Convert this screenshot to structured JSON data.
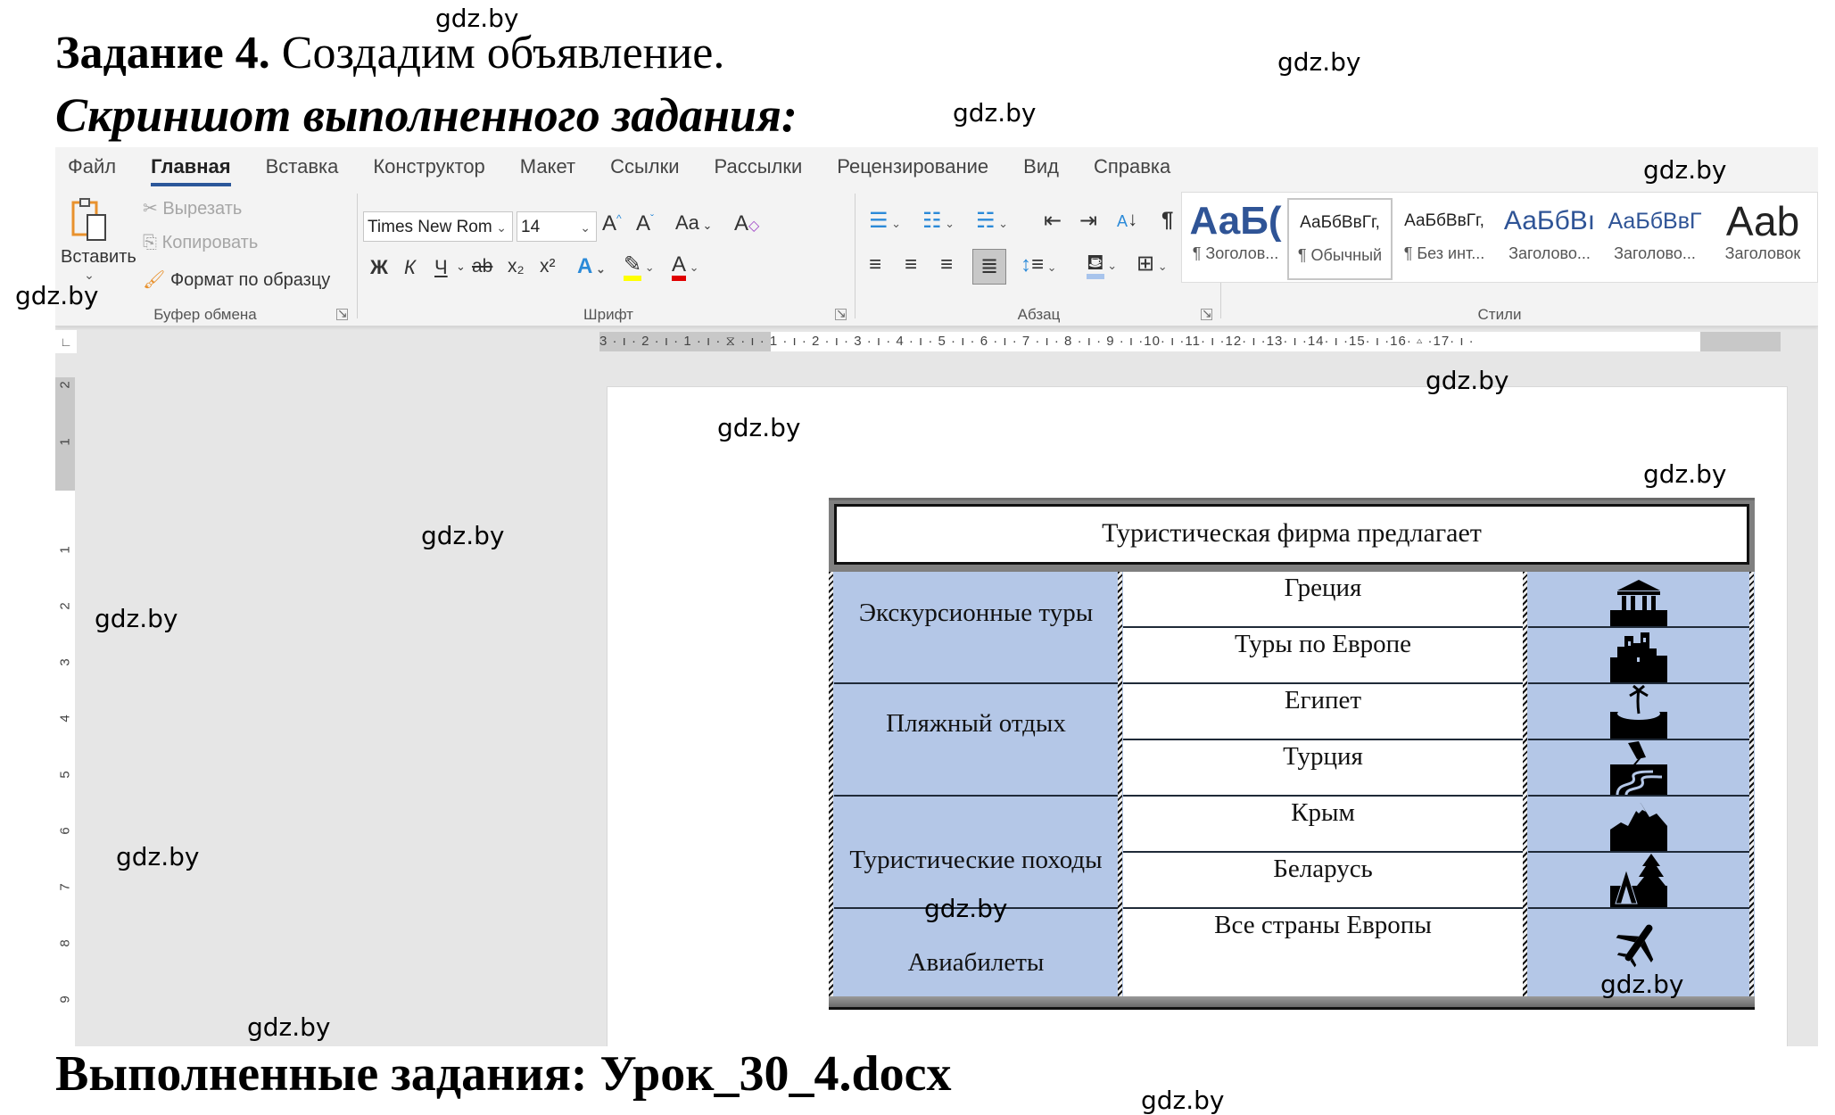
{
  "heading": {
    "task_bold": "Задание 4.",
    "task_rest": " Создадим объявление.",
    "screenshot_label": "Скриншот выполненного задания:",
    "result_label": "Выполненные задания: Урок_30_4.docx"
  },
  "watermark": "gdz.by",
  "ribbon": {
    "tabs": [
      "Файл",
      "Главная",
      "Вставка",
      "Конструктор",
      "Макет",
      "Ссылки",
      "Рассылки",
      "Рецензирование",
      "Вид",
      "Справка"
    ],
    "active_tab": "Главная",
    "clipboard": {
      "paste": "Вставить",
      "cut": "Вырезать",
      "copy": "Копировать",
      "format_painter": "Формат по образцу",
      "label": "Буфер обмена"
    },
    "font": {
      "font_name": "Times New Rom",
      "font_size": "14",
      "grow": "A",
      "shrink": "A",
      "change_case": "Aa",
      "bold": "Ж",
      "italic": "К",
      "underline": "Ч",
      "strikethrough": "ab",
      "subscript": "x₂",
      "superscript": "x²",
      "label": "Шрифт",
      "highlight_color": "#ffff00",
      "font_color": "#e00000"
    },
    "paragraph": {
      "label": "Абзац",
      "pilcrow": "¶"
    },
    "styles": {
      "label": "Стили",
      "items": [
        {
          "sample": "АаБ(",
          "name": "¶ Зоголов..."
        },
        {
          "sample": "АаБбВвГг,",
          "name": "¶ Обычный"
        },
        {
          "sample": "АаБбВвГг,",
          "name": "¶ Без инт..."
        },
        {
          "sample": "АаБбВı",
          "name": "Заголово..."
        },
        {
          "sample": "АаБбВвГ",
          "name": "Заголово..."
        },
        {
          "sample": "Ааb",
          "name": "Заголовок"
        }
      ],
      "selected": "¶ Обычный"
    }
  },
  "ruler": {
    "horizontal": "3 · ı · 2 · ı · 1 · ı · ⧖ · ı · 1 · ı · 2 · ı · 3 · ı · 4 · ı · 5 · ı · 6 · ı · 7 · ı · 8 · ı · 9 · ı ·10· ı ·11· ı ·12· ı ·13· ı ·14· ı ·15· ı ·16· ▵ ·17· ı ·",
    "vertical": [
      "2",
      "1",
      "1",
      "2",
      "3",
      "4",
      "5",
      "6",
      "7",
      "8",
      "9"
    ]
  },
  "document": {
    "table": {
      "title": "Туристическая фирма предлагает",
      "groups": [
        {
          "category": "Экскурсионные туры",
          "items": [
            {
              "destination": "Греция",
              "icon": "temple-icon"
            },
            {
              "destination": "Туры по Европе",
              "icon": "city-skyline-icon"
            }
          ]
        },
        {
          "category": "Пляжный отдых",
          "items": [
            {
              "destination": "Египет",
              "icon": "palm-island-icon"
            },
            {
              "destination": "Турция",
              "icon": "beach-umbrella-icon"
            }
          ]
        },
        {
          "category": "Туристические походы",
          "items": [
            {
              "destination": "Крым",
              "icon": "mountain-icon"
            },
            {
              "destination": "Беларусь",
              "icon": "tent-forest-icon"
            }
          ]
        },
        {
          "category": "Авиабилеты",
          "items": [
            {
              "destination": "Все страны Европы",
              "icon": "airplane-icon"
            }
          ]
        }
      ],
      "fill_color": "#b4c7e7"
    }
  }
}
